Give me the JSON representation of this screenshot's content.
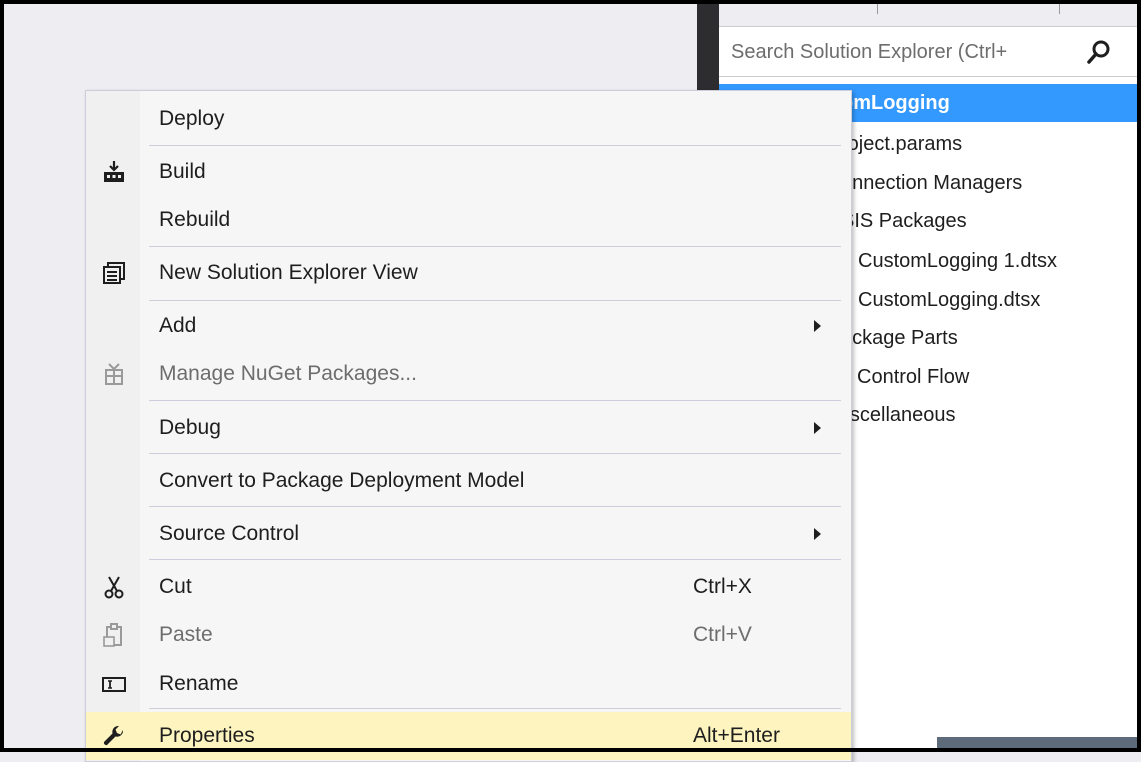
{
  "solution_explorer": {
    "search_placeholder": "Search Solution Explorer (Ctrl+",
    "tree": [
      {
        "label": "omLogging",
        "selected": true
      },
      {
        "label": "roject.params"
      },
      {
        "label": "onnection Managers"
      },
      {
        "label": "SIS Packages"
      },
      {
        "label": "CustomLogging 1.dtsx"
      },
      {
        "label": "CustomLogging.dtsx"
      },
      {
        "label": "ackage Parts"
      },
      {
        "label": "Control Flow"
      },
      {
        "label": "liscellaneous"
      }
    ]
  },
  "context_menu": {
    "items": [
      {
        "label": "Deploy"
      },
      {
        "label": "Build",
        "icon": "build-icon"
      },
      {
        "label": "Rebuild"
      },
      {
        "label": "New Solution Explorer View",
        "icon": "new-view-icon"
      },
      {
        "label": "Add",
        "submenu": true
      },
      {
        "label": "Manage NuGet Packages...",
        "icon": "nuget-icon",
        "disabled": true
      },
      {
        "label": "Debug",
        "submenu": true
      },
      {
        "label": "Convert to Package Deployment Model"
      },
      {
        "label": "Source Control",
        "submenu": true
      },
      {
        "label": "Cut",
        "icon": "scissors-icon",
        "shortcut": "Ctrl+X"
      },
      {
        "label": "Paste",
        "icon": "paste-icon",
        "shortcut": "Ctrl+V",
        "disabled": true
      },
      {
        "label": "Rename",
        "icon": "rename-icon"
      },
      {
        "label": "Properties",
        "icon": "wrench-icon",
        "shortcut": "Alt+Enter",
        "highlighted": true
      }
    ]
  },
  "colors": {
    "selection_blue": "#3399ff",
    "highlight_yellow": "#fdf4bf",
    "menu_bg": "#f6f6f6",
    "dark_divider": "#2d2d30"
  }
}
